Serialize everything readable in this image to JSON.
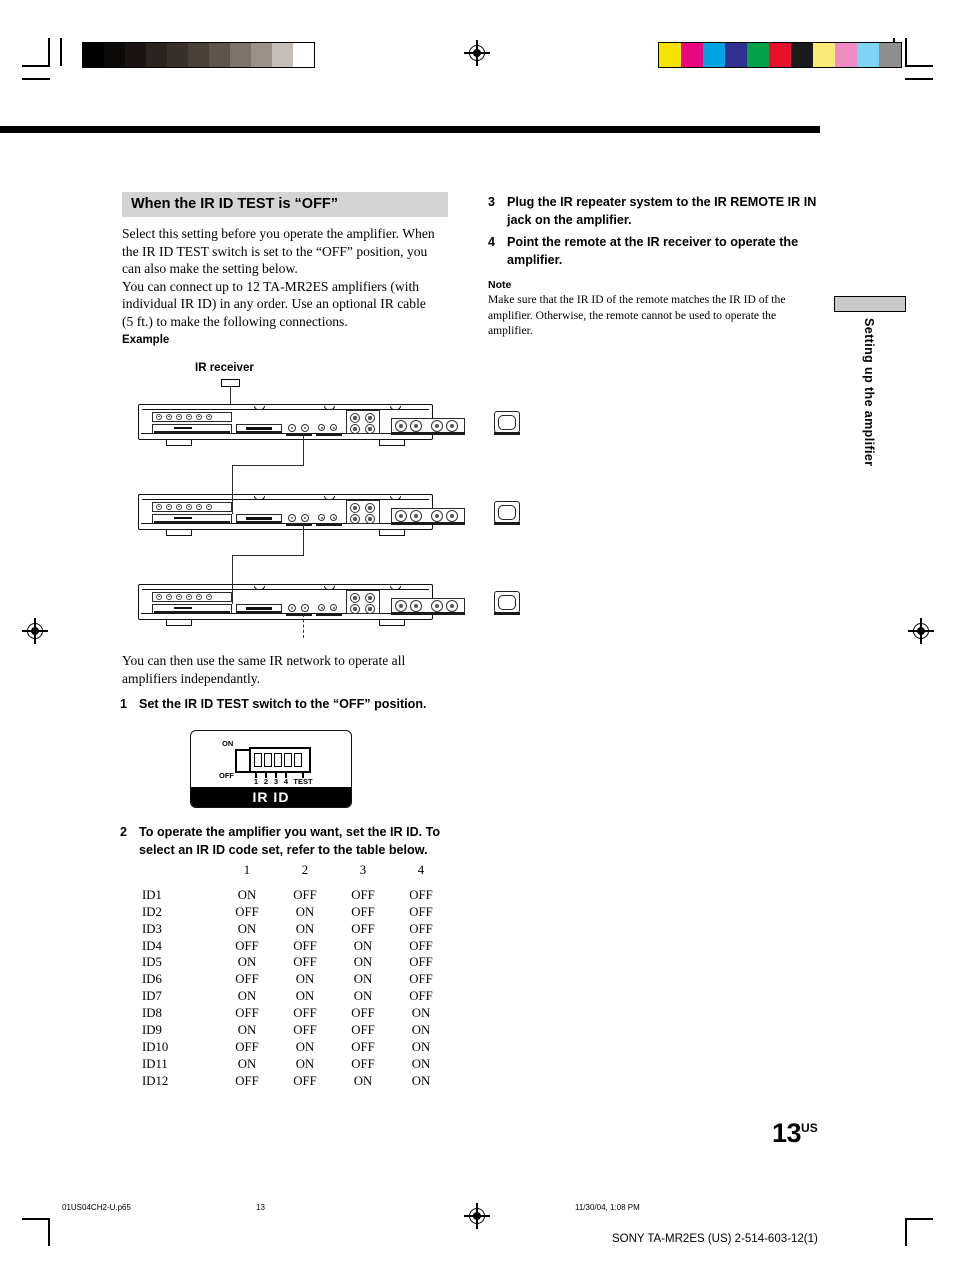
{
  "document": {
    "page_number": "13",
    "page_number_suffix": "US",
    "side_tab": "Setting up the amplifier"
  },
  "section": {
    "heading": "When the IR ID TEST is “OFF”",
    "paragraph": "Select this setting before you operate the amplifier. When the IR ID TEST switch is set to the “OFF” position, you can also make the setting below. You can connect up to 12 TA-MR2ES amplifiers (with individual IR ID) in any order. Use an optional IR cable (5 ft.) to make the following connections.",
    "paragraph_lines": [
      "Select this setting before you operate the amplifier. When",
      "the IR ID TEST switch is set to the “OFF” position, you",
      "can also make the setting below.",
      "You can connect up to 12 TA-MR2ES amplifiers (with",
      "individual IR ID) in any order. Use an optional IR cable",
      "(5 ft.) to make the following connections."
    ],
    "example_label": "Example"
  },
  "diagram": {
    "ir_receiver_label": "IR receiver",
    "after_text_lines": [
      "You can then use the same IR network to operate all",
      "amplifiers independantly."
    ]
  },
  "steps_left": [
    {
      "num": "1",
      "text": "Set the IR ID TEST switch to the “OFF” position."
    },
    {
      "num": "2",
      "text": "To operate the amplifier you want, set the IR ID. To select an IR ID code set, refer to the table below.",
      "lines": [
        "To operate the amplifier you want, set the IR ID. To",
        "select an IR ID code set, refer to the table below."
      ]
    }
  ],
  "steps_right": [
    {
      "num": "3",
      "text": "Plug the IR repeater system to the IR REMOTE IR IN jack on the amplifier.",
      "lines": [
        "Plug the IR repeater system to the IR REMOTE IR IN",
        "jack on the amplifier."
      ]
    },
    {
      "num": "4",
      "text": "Point the remote at the IR receiver to operate the amplifier.",
      "lines": [
        "Point the remote at the IR receiver to operate the",
        "amplifier."
      ]
    }
  ],
  "note": {
    "heading": "Note",
    "lines": [
      "Make sure that the IR ID of the remote matches the IR ID of the",
      "amplifier. Otherwise, the remote cannot be used to operate the",
      "amplifier."
    ]
  },
  "irid_switch": {
    "on_label": "ON",
    "off_label": "OFF",
    "title": "IR ID",
    "switch_numbers": [
      "1",
      "2",
      "3",
      "4"
    ],
    "test_label": "TEST",
    "switch_count": 5
  },
  "id_table": {
    "columns": [
      "1",
      "2",
      "3",
      "4"
    ],
    "rows": [
      {
        "id": "ID1",
        "values": [
          "ON",
          "OFF",
          "OFF",
          "OFF"
        ]
      },
      {
        "id": "ID2",
        "values": [
          "OFF",
          "ON",
          "OFF",
          "OFF"
        ]
      },
      {
        "id": "ID3",
        "values": [
          "ON",
          "ON",
          "OFF",
          "OFF"
        ]
      },
      {
        "id": "ID4",
        "values": [
          "OFF",
          "OFF",
          "ON",
          "OFF"
        ]
      },
      {
        "id": "ID5",
        "values": [
          "ON",
          "OFF",
          "ON",
          "OFF"
        ]
      },
      {
        "id": "ID6",
        "values": [
          "OFF",
          "ON",
          "ON",
          "OFF"
        ]
      },
      {
        "id": "ID7",
        "values": [
          "ON",
          "ON",
          "ON",
          "OFF"
        ]
      },
      {
        "id": "ID8",
        "values": [
          "OFF",
          "OFF",
          "OFF",
          "ON"
        ]
      },
      {
        "id": "ID9",
        "values": [
          "ON",
          "OFF",
          "OFF",
          "ON"
        ]
      },
      {
        "id": "ID10",
        "values": [
          "OFF",
          "ON",
          "OFF",
          "ON"
        ]
      },
      {
        "id": "ID11",
        "values": [
          "ON",
          "ON",
          "OFF",
          "ON"
        ]
      },
      {
        "id": "ID12",
        "values": [
          "OFF",
          "OFF",
          "ON",
          "ON"
        ]
      }
    ]
  },
  "footer": {
    "file_name": "01US04CH2-U.p65",
    "page": "13",
    "timestamp": "11/30/04, 1:08 PM",
    "publication": "SONY TA-MR2ES (US) 2-514-603-12(1)"
  },
  "print_marks": {
    "gray_wedge": [
      "#000000",
      "#0d0a0a",
      "#1a1514",
      "#2a2320",
      "#38302c",
      "#4a4039",
      "#5f544c",
      "#7d736b",
      "#9a918a",
      "#c4bdb8",
      "#ffffff"
    ],
    "color_bar": [
      "#f5e400",
      "#e8077e",
      "#00a3e0",
      "#2e3192",
      "#00a24a",
      "#e8112b",
      "#1a1a1a",
      "#faea78",
      "#f08cc4",
      "#7fd4f5",
      "#8e8e8e"
    ]
  }
}
